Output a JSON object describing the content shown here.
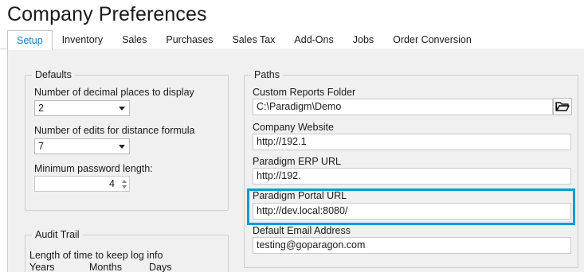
{
  "window": {
    "title": "Company Preferences"
  },
  "tabs": [
    "Setup",
    "Inventory",
    "Sales",
    "Purchases",
    "Sales Tax",
    "Add-Ons",
    "Jobs",
    "Order Conversion"
  ],
  "defaults": {
    "legend": "Defaults",
    "decimal_label": "Number of decimal places to display",
    "decimal_value": "2",
    "edits_label": "Number of edits for distance formula",
    "edits_value": "7",
    "password_label": "Minimum password length:",
    "password_value": "4"
  },
  "audit": {
    "legend": "Audit Trail",
    "keep_label": "Length of time to keep log info",
    "years_label": "Years",
    "months_label": "Months",
    "days_label": "Days"
  },
  "paths": {
    "legend": "Paths",
    "reports_label": "Custom Reports Folder",
    "reports_value": "C:\\Paradigm\\Demo",
    "website_label": "Company Website",
    "website_value": "http://192.1",
    "erp_label": "Paradigm ERP URL",
    "erp_value": "http://192.",
    "portal_label": "Paradigm Portal URL",
    "portal_value": "http://dev.local:8080/",
    "email_label": "Default Email Address",
    "email_value": "testing@goparagon.com"
  },
  "colors": {
    "accent": "#1f7fbf",
    "highlight": "#0b9bd8",
    "panel": "#f0f0f0"
  }
}
